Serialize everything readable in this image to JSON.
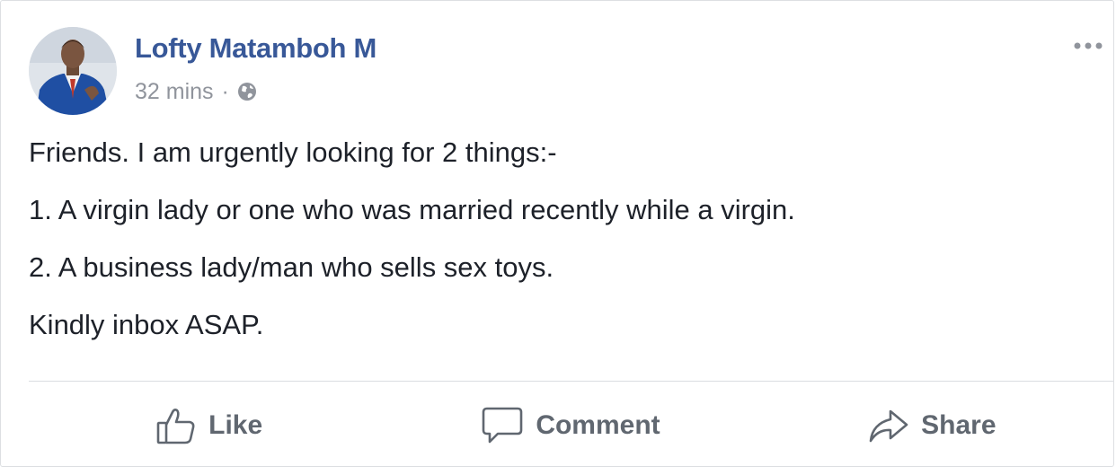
{
  "post": {
    "author": "Lofty Matamboh M",
    "timestamp": "32 mins",
    "separator": "·",
    "privacy_icon": "globe-icon",
    "more_icon": "more-options-icon",
    "lines": [
      "Friends. I am urgently looking for 2 things:-",
      "1. A virgin lady or one who was married recently while a virgin.",
      "2. A business lady/man who sells sex toys.",
      "Kindly inbox ASAP."
    ]
  },
  "actions": {
    "like": {
      "label": "Like",
      "icon": "thumbs-up-icon"
    },
    "comment": {
      "label": "Comment",
      "icon": "speech-bubble-icon"
    },
    "share": {
      "label": "Share",
      "icon": "share-arrow-icon"
    }
  },
  "colors": {
    "author": "#385898",
    "text": "#1d2129",
    "meta": "#90949c",
    "action": "#606770",
    "divider": "#dadde1"
  }
}
